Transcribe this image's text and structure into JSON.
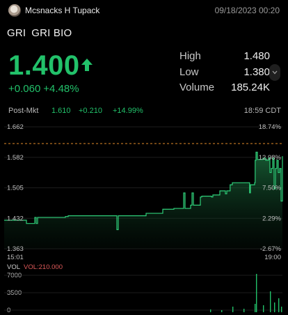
{
  "header": {
    "username": "Mcsnacks H Tupack",
    "timestamp": "09/18/2023 00:20"
  },
  "quote": {
    "symbol": "GRI",
    "name": "GRI BIO",
    "price": "1.400",
    "change": "+0.060",
    "change_pct": "+4.48%",
    "direction": "up",
    "up_color": "#22c16a"
  },
  "stats": [
    {
      "label": "High",
      "value": "1.480"
    },
    {
      "label": "Low",
      "value": "1.380"
    },
    {
      "label": "Volume",
      "value": "185.24K"
    }
  ],
  "post_market": {
    "label": "Post-Mkt",
    "price": "1.610",
    "change": "+0.210",
    "change_pct": "+14.99%",
    "time": "18:59 CDT"
  },
  "chart_data": {
    "type": "line",
    "y_left_ticks": [
      "1.662",
      "1.582",
      "1.505",
      "1.432",
      "1.363"
    ],
    "y_right_ticks": [
      "18.74%",
      "12.98%",
      "7.50%",
      "2.29%",
      "-2.67%"
    ],
    "x_ticks": [
      "15:01",
      "19:00"
    ],
    "ylim": [
      1.363,
      1.662
    ],
    "prev_close": 1.4,
    "series": [
      {
        "x": [
          0.0,
          0.07,
          0.08,
          0.1,
          0.11,
          0.115,
          0.12,
          0.2,
          0.22,
          0.23,
          0.4,
          0.405,
          0.41,
          0.5,
          0.51,
          0.56,
          0.57,
          0.6,
          0.61,
          0.64,
          0.645,
          0.65,
          0.66,
          0.67,
          0.675,
          0.68,
          0.7,
          0.705,
          0.71,
          0.74,
          0.745,
          0.75,
          0.77,
          0.775,
          0.78,
          0.79,
          0.795,
          0.8,
          0.81,
          0.812,
          0.815,
          0.82,
          0.84,
          0.86,
          0.88,
          0.882,
          0.885,
          0.9,
          0.902,
          0.905,
          0.91,
          0.93,
          0.935,
          0.94,
          0.95,
          0.955,
          0.96,
          0.965,
          0.97,
          0.975,
          0.98,
          0.985,
          0.99,
          0.995,
          1.0
        ],
        "y": [
          1.433,
          1.433,
          1.425,
          1.425,
          1.44,
          1.425,
          1.44,
          1.44,
          1.442,
          1.444,
          1.444,
          1.41,
          1.444,
          1.444,
          1.45,
          1.45,
          1.46,
          1.46,
          1.462,
          1.462,
          1.5,
          1.462,
          1.462,
          1.47,
          1.5,
          1.47,
          1.47,
          1.49,
          1.492,
          1.492,
          1.49,
          1.495,
          1.495,
          1.505,
          1.505,
          1.505,
          1.498,
          1.505,
          1.505,
          1.52,
          1.52,
          1.525,
          1.525,
          1.525,
          1.525,
          1.5,
          1.52,
          1.525,
          1.58,
          1.6,
          1.582,
          1.585,
          1.585,
          1.58,
          1.585,
          1.55,
          1.56,
          1.585,
          1.51,
          1.56,
          1.58,
          1.55,
          1.56,
          1.48,
          1.59
        ]
      }
    ],
    "volume": {
      "label": "VOL",
      "value_label": "VOL:210.000",
      "ticks": [
        "7000",
        "3500",
        "0"
      ]
    }
  }
}
